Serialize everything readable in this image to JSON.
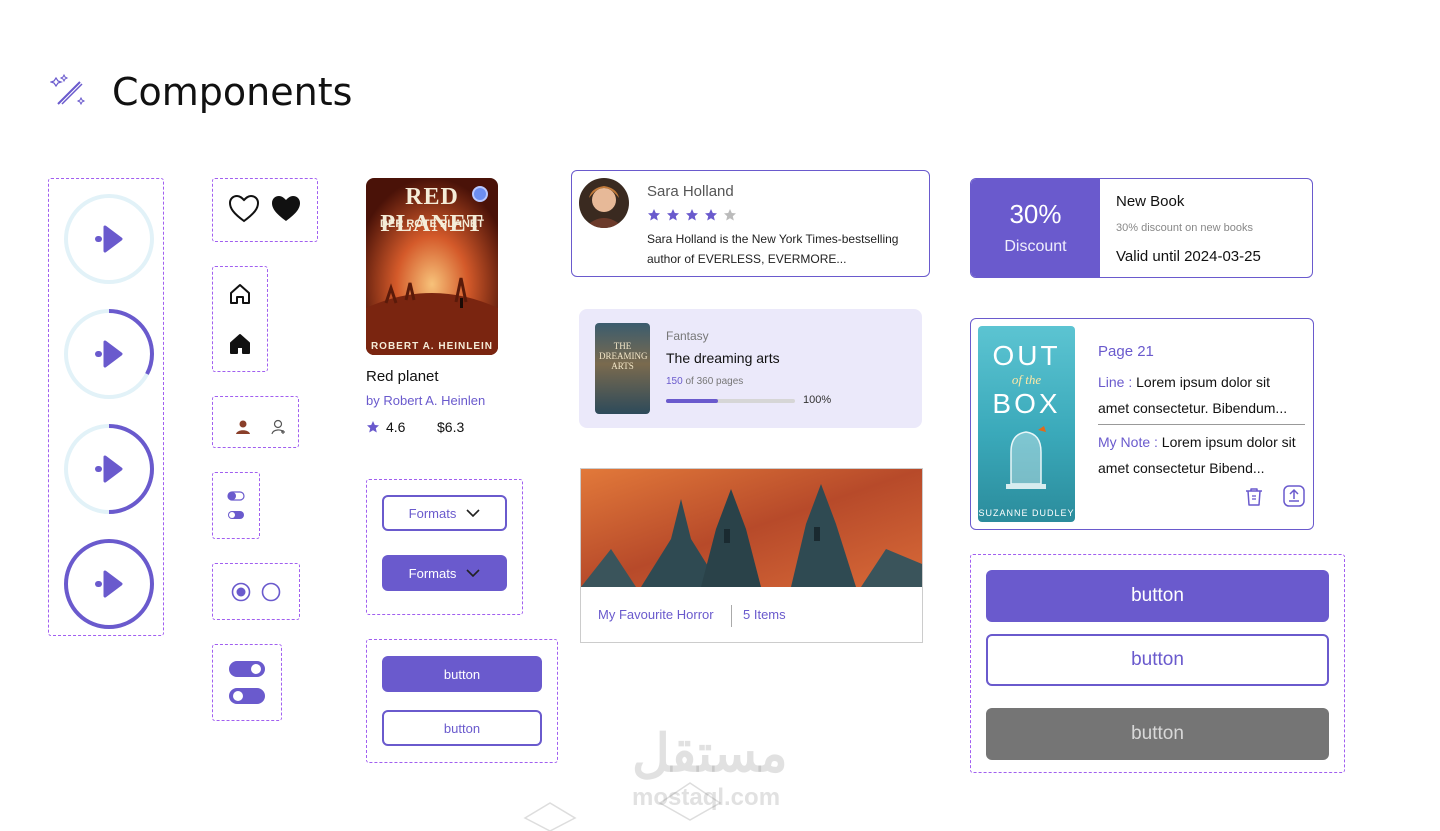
{
  "header": {
    "title": "Components",
    "icon": "magic-wand-icon"
  },
  "colors": {
    "accent": "#6a5acd",
    "accent_light": "#ebe9fa",
    "dash": "#a15ff0",
    "gray_button": "#757575",
    "ring_bg": "#e2f2f8"
  },
  "play_buttons": [
    {
      "icon": "play-icon",
      "progress": 0.0
    },
    {
      "icon": "play-icon",
      "progress": 0.25
    },
    {
      "icon": "play-icon",
      "progress": 0.5
    },
    {
      "icon": "play-icon",
      "progress": 1.0
    }
  ],
  "book": {
    "cover_title": "RED PLANET",
    "cover_subtitle": "DER ROTE PLANET",
    "cover_author": "ROBERT A. HEINLEIN",
    "title": "Red planet",
    "author": "by Robert A. Heinlen",
    "rating": "4.6",
    "price": "$6.3"
  },
  "formats": {
    "outline_label": "Formats",
    "filled_label": "Formats"
  },
  "small_buttons": {
    "filled_label": "button",
    "outline_label": "button"
  },
  "author_card": {
    "name": "Sara Holland",
    "stars_filled": 4,
    "stars_total": 5,
    "bio": "Sara Holland is the New York Times-bestselling author of EVERLESS, EVERMORE..."
  },
  "reading_card": {
    "cover_title": "THE DREAMING ARTS",
    "genre": "Fantasy",
    "title": "The dreaming arts",
    "pages_read": "150",
    "pages_rest": "of 360 pages",
    "progress_label": "100%",
    "progress": 0.4
  },
  "collection": {
    "name": "My Favourite Horror",
    "count": "5 Items"
  },
  "discount": {
    "percent": "30%",
    "label": "Discount",
    "title": "New Book",
    "subtitle": "30% discount on new books",
    "valid": "Valid until 2024-03-25"
  },
  "note_card": {
    "cover_line1": "OUT",
    "cover_line2": "of the",
    "cover_line3": "BOX",
    "cover_author": "SUZANNE DUDLEY",
    "page": "Page 21",
    "line_label": "Line :",
    "line_text": "Lorem ipsum dolor sit amet consectetur. Bibendum...",
    "note_label": "My Note :",
    "note_text": "Lorem ipsum dolor sit amet consectetur Bibend..."
  },
  "big_buttons": {
    "filled_label": "button",
    "outline_label": "button",
    "disabled_label": "button"
  },
  "watermark": {
    "arabic": "مستقل",
    "latin": "mostaql.com"
  }
}
